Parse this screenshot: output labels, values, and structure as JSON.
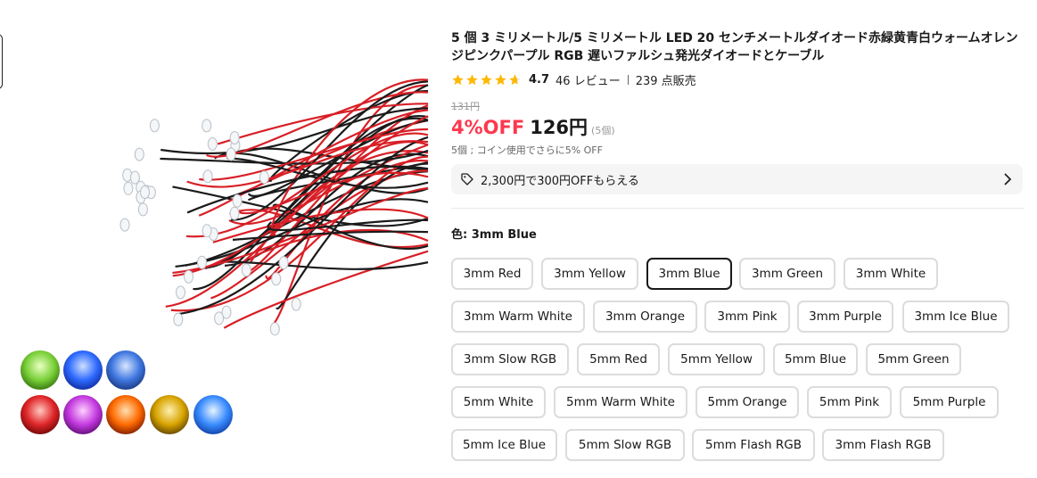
{
  "product": {
    "title": "5 個 3 ミリメートル/5 ミリメートル LED 20 センチメートルダイオード赤緑黄青白ウォームオレンジピンクパープル RGB 遅いファルシュ発光ダイオードとケーブル",
    "rating": "4.7",
    "reviews": "46 レビュー",
    "sold": "239 点販売",
    "stars": 4.7
  },
  "price": {
    "original": "131円",
    "discount": "4%OFF",
    "current": "126円",
    "unit": "(5個)",
    "coin_note": "5個 ; コイン使用でさらに5% OFF"
  },
  "coupon": {
    "text": "2,300円で300円OFFもらえる"
  },
  "color": {
    "label": "色: 3mm Blue",
    "options": [
      "3mm Red",
      "3mm Yellow",
      "3mm Blue",
      "3mm Green",
      "3mm White",
      "3mm Warm White",
      "3mm Orange",
      "3mm Pink",
      "3mm Purple",
      "3mm Ice Blue",
      "3mm Slow RGB",
      "5mm Red",
      "5mm Yellow",
      "5mm Blue",
      "5mm Green",
      "5mm White",
      "5mm Warm White",
      "5mm Orange",
      "5mm Pink",
      "5mm Purple",
      "5mm Ice Blue",
      "5mm Slow RGB",
      "5mm Flash RGB",
      "3mm Flash RGB"
    ],
    "selected": "3mm Blue"
  },
  "icons": [
    "star-icon",
    "tag-icon",
    "chevron-right-icon"
  ],
  "colors": {
    "accent_red": "#fd384f",
    "star": "#ffb800",
    "led_green": "#7bd13a",
    "led_blue": "#2f6bff",
    "led_red": "#e0262a",
    "led_purple": "#c43be0",
    "led_orange": "#ff6a00",
    "led_yellow": "#e8b400"
  }
}
